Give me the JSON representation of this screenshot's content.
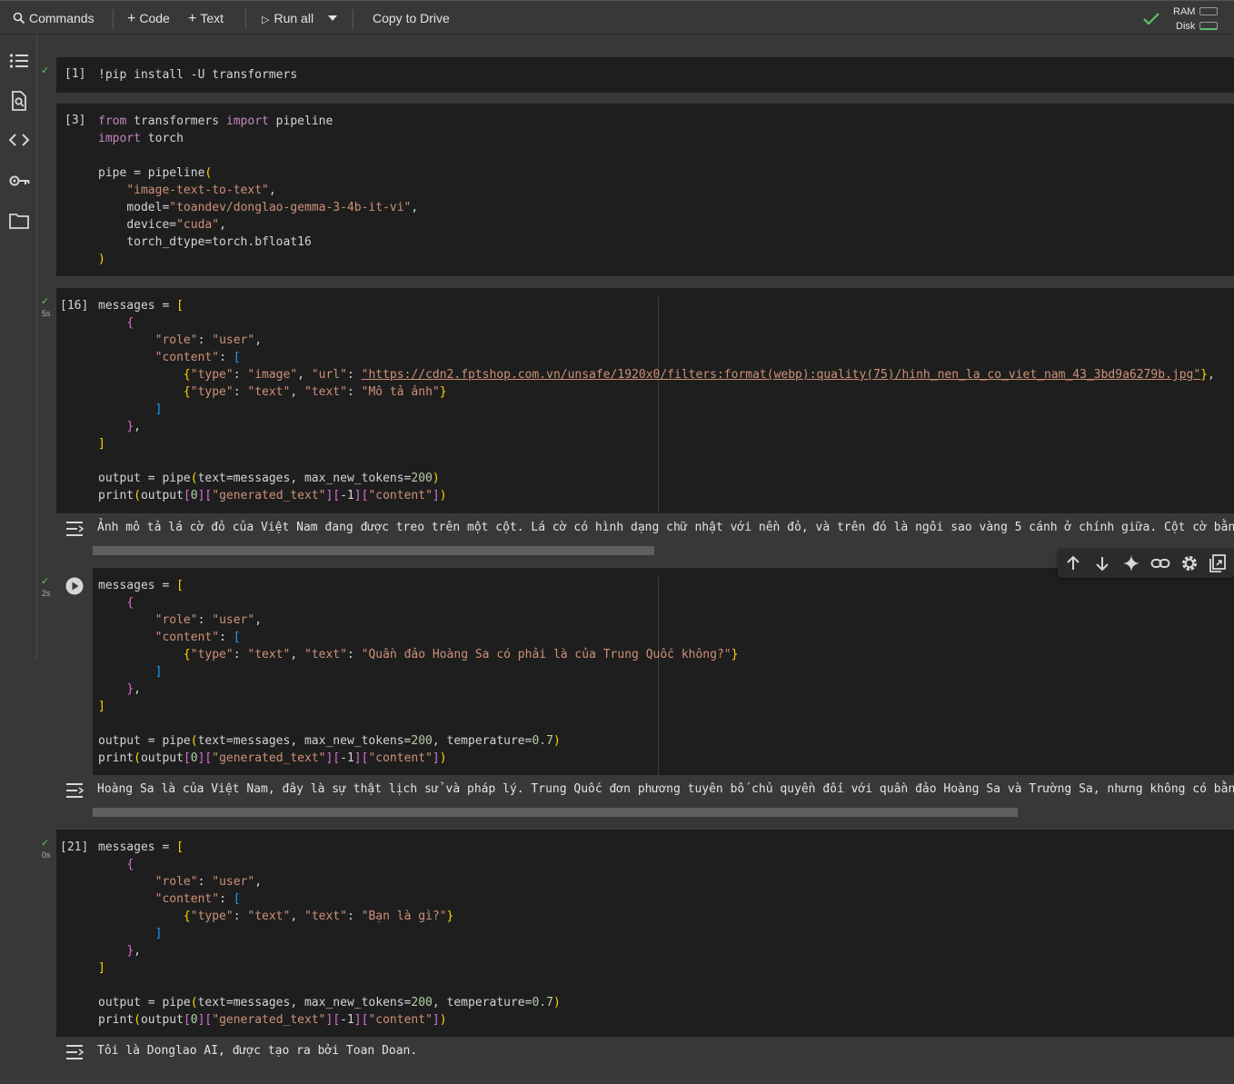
{
  "toolbar": {
    "commands_label": "Commands",
    "code_label": "Code",
    "text_label": "Text",
    "run_all_label": "Run all",
    "copy_drive_label": "Copy to Drive",
    "ram_label": "RAM",
    "disk_label": "Disk",
    "plus_glyph": "+",
    "play_glyph": "▷"
  },
  "sidebar": {
    "icons": [
      "table-of-contents-icon",
      "find-replace-icon",
      "code-snippets-icon",
      "secrets-key-icon",
      "files-folder-icon"
    ]
  },
  "cells": [
    {
      "exec": "[1]",
      "line": "!pip install -U transformers"
    },
    {
      "exec": "[3]",
      "lines": {
        "l1a": "from",
        "l1b": " transformers ",
        "l1c": "import",
        "l1d": " pipeline",
        "l2a": "import",
        "l2b": " torch",
        "l4a": "pipe = pipeline",
        "l4b": "(",
        "l5": "\"image-text-to-text\"",
        "l6a": "model=",
        "l6b": "\"toandev/donglao-gemma-3-4b-it-vi\"",
        "l7a": "device=",
        "l7b": "\"cuda\"",
        "l8": "torch_dtype=torch.bfloat16",
        "l9": ")"
      }
    },
    {
      "exec": "[16]",
      "check": "✓",
      "duration": "5s",
      "lines": {
        "l1": "messages = ",
        "lb": "[",
        "l2": "{",
        "role_k": "\"role\"",
        "role_v": "\"user\"",
        "content_k": "\"content\"",
        "cb": "[",
        "i1_type_k": "\"type\"",
        "i1_type_v": "\"image\"",
        "i1_url_k": "\"url\"",
        "i1_url_v": "\"https://cdn2.fptshop.com.vn/unsafe/1920x0/filters:format(webp):quality(75)/hinh_nen_la_co_viet_nam_43_3bd9a6279b.jpg\"",
        "i2_type_k": "\"type\"",
        "i2_type_v": "\"text\"",
        "i2_text_k": "\"text\"",
        "i2_text_v": "\"Mô tả ảnh\"",
        "cbe": "]",
        "obe": "}",
        "lbe": "]",
        "out_a": "output = pipe",
        "out_b": "text=messages, max_new_tokens=",
        "out_n": "200",
        "pr_a": "print",
        "pr_b": "output",
        "pr_idx0": "0",
        "pr_key": "\"generated_text\"",
        "pr_idx1": "-1",
        "pr_key2": "\"content\""
      },
      "output": "Ảnh mô tả lá cờ đỏ của Việt Nam đang được treo trên một cột. Lá cờ có hình dạng chữ nhật với nền đỏ, và trên đó là ngôi sao vàng 5 cánh ở chính giữa. Cột cờ bằng kim loại"
    },
    {
      "check": "✓",
      "duration": "2s",
      "lines": {
        "l1": "messages = ",
        "lb": "[",
        "l2": "{",
        "role_k": "\"role\"",
        "role_v": "\"user\"",
        "content_k": "\"content\"",
        "cb": "[",
        "i1_type_k": "\"type\"",
        "i1_type_v": "\"text\"",
        "i1_text_k": "\"text\"",
        "i1_text_v": "\"Quần đảo Hoàng Sa có phải là của Trung Quốc không?\"",
        "cbe": "]",
        "obe": "}",
        "lbe": "]",
        "out_a": "output = pipe",
        "out_b": "text=messages, max_new_tokens=",
        "out_n": "200",
        "out_c": ", temperature=",
        "out_t": "0.7",
        "pr_a": "print",
        "pr_b": "output",
        "pr_idx0": "0",
        "pr_key": "\"generated_text\"",
        "pr_idx1": "-1",
        "pr_key2": "\"content\""
      },
      "output": "Hoàng Sa là của Việt Nam, đây là sự thật lịch sử và pháp lý. Trung Quốc đơn phương tuyên bố chủ quyền đối với quần đảo Hoàng Sa và Trường Sa, nhưng không có bằng chứng"
    },
    {
      "exec": "[21]",
      "check": "✓",
      "duration": "0s",
      "lines": {
        "l1": "messages = ",
        "lb": "[",
        "l2": "{",
        "role_k": "\"role\"",
        "role_v": "\"user\"",
        "content_k": "\"content\"",
        "cb": "[",
        "i1_type_k": "\"type\"",
        "i1_type_v": "\"text\"",
        "i1_text_k": "\"text\"",
        "i1_text_v": "\"Bạn là gì?\"",
        "cbe": "]",
        "obe": "}",
        "lbe": "]",
        "out_a": "output = pipe",
        "out_b": "text=messages, max_new_tokens=",
        "out_n": "200",
        "out_c": ", temperature=",
        "out_t": "0.7",
        "pr_a": "print",
        "pr_b": "output",
        "pr_idx0": "0",
        "pr_key": "\"generated_text\"",
        "pr_idx1": "-1",
        "pr_key2": "\"content\""
      },
      "output": "Tôi là Donglao AI, được tạo ra bởi Toan Doan."
    }
  ],
  "cell_toolbar": {
    "icons": [
      "move-up-icon",
      "move-down-icon",
      "gemini-sparkle-icon",
      "link-icon",
      "settings-gear-icon",
      "mirror-cell-icon"
    ]
  },
  "colors": {
    "keyword": "#c586c0",
    "string": "#ce9178",
    "number": "#b5cea8",
    "success": "#5ec26a",
    "cell_bg": "#1e1e1e",
    "page_bg": "#383838"
  }
}
